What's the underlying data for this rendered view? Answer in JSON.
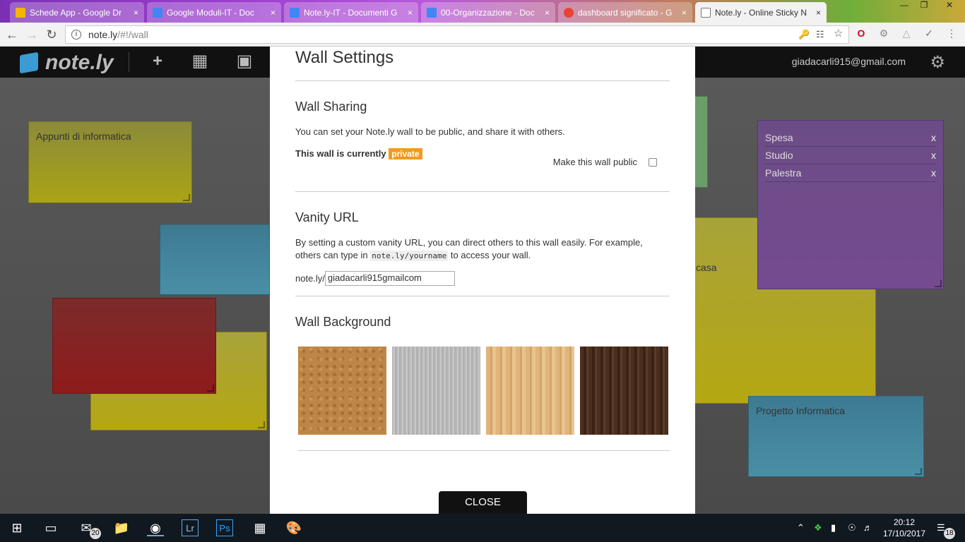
{
  "browser": {
    "tabs": [
      {
        "title": "Schede App - Google Dr",
        "fav": "#f4b400"
      },
      {
        "title": "Google Moduli-IT - Doc",
        "fav": "#4285f4"
      },
      {
        "title": "Note.ly-IT - Documenti G",
        "fav": "#4285f4"
      },
      {
        "title": "00-Organizzazione - Doc",
        "fav": "#4285f4"
      },
      {
        "title": "dashboard significato - G",
        "fav": "#ea4335"
      },
      {
        "title": "Note.ly - Online Sticky N",
        "fav": "#777777"
      }
    ],
    "url_host": "note.ly",
    "url_path": "/#!/wall",
    "tab_close": "×"
  },
  "app": {
    "logo_text": "note.ly",
    "add_icon": "+",
    "user_email": "giadacarli915@gmail.com"
  },
  "notes": {
    "appunti": "Appunti di informatica",
    "progetto": "Progetto Informatica",
    "casa": "casa",
    "list": [
      {
        "label": "Spesa",
        "remove": "x"
      },
      {
        "label": "Studio",
        "remove": "x"
      },
      {
        "label": "Palestra",
        "remove": "x"
      }
    ]
  },
  "modal": {
    "title": "Wall Settings",
    "sharing_heading": "Wall Sharing",
    "sharing_desc": "You can set your Note.ly wall to be public, and share it with others.",
    "status_label": "This wall is currently",
    "status_badge": "private",
    "public_label": "Make this wall public",
    "vanity_heading": "Vanity URL",
    "vanity_desc_1": "By setting a custom vanity URL, you can direct others to this wall easily. For example, others can type in",
    "vanity_code": "note.ly/yourname",
    "vanity_desc_2": "to access your wall.",
    "vanity_prefix": "note.ly/",
    "vanity_value": "giadacarli915gmailcom",
    "background_heading": "Wall Background",
    "backgrounds": [
      "cork",
      "brushed-metal",
      "bamboo",
      "walnut"
    ],
    "close_label": "CLOSE"
  },
  "taskbar": {
    "mail_badge": "20",
    "notif_badge": "18",
    "time": "20:12",
    "date": "17/10/2017",
    "lr": "Lr",
    "ps": "Ps"
  }
}
